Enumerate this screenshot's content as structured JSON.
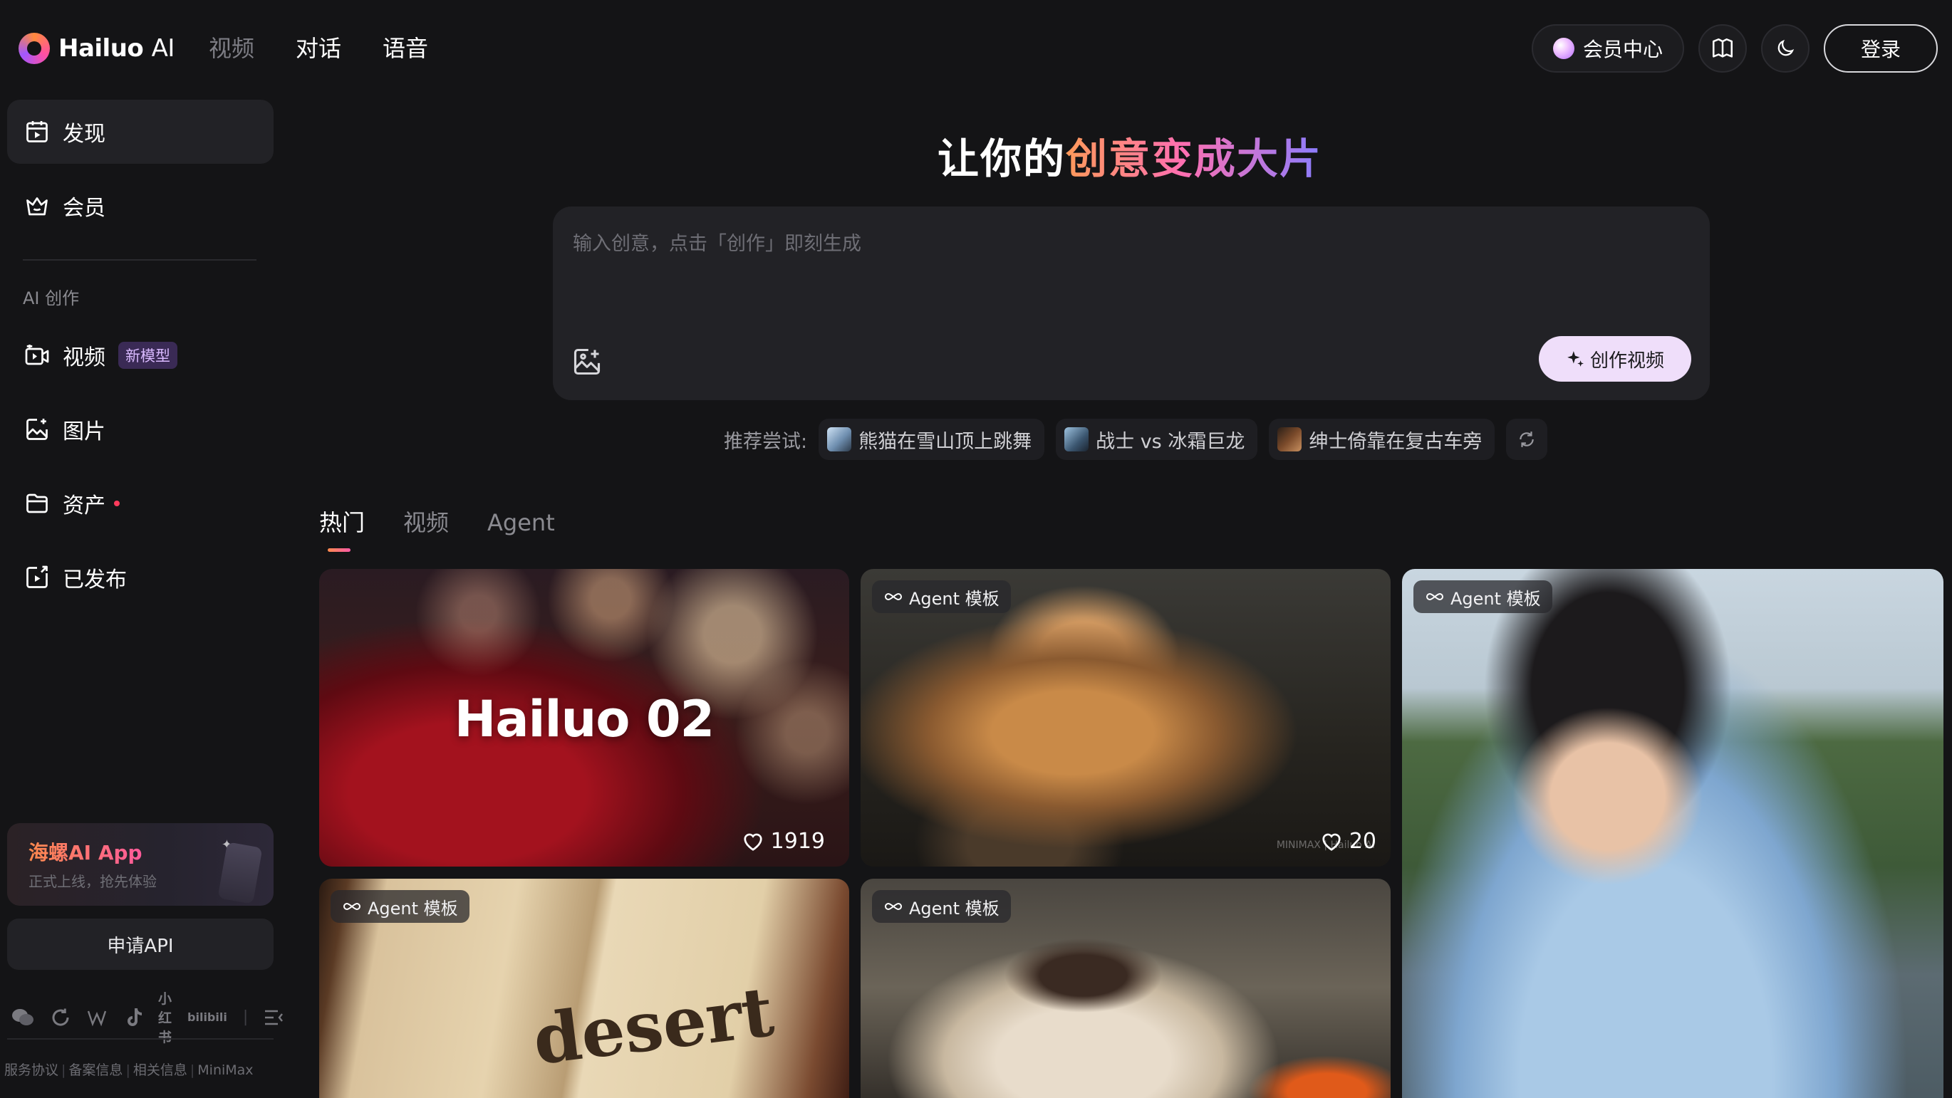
{
  "app": {
    "brand": "Hailuo",
    "brand_suffix": "AI"
  },
  "topnav": {
    "items": [
      {
        "label": "视频",
        "active": false
      },
      {
        "label": "对话",
        "active": true
      },
      {
        "label": "语音",
        "active": true
      }
    ]
  },
  "header_right": {
    "member_center_label": "会员中心",
    "login_label": "登录"
  },
  "sidebar": {
    "discover_label": "发现",
    "member_label": "会员",
    "section_title": "AI 创作",
    "video_label": "视频",
    "video_badge": "新模型",
    "image_label": "图片",
    "assets_label": "资产",
    "published_label": "已发布",
    "app_card": {
      "title": "海螺AI App",
      "subtitle": "正式上线，抢先体验"
    },
    "api_label": "申请API",
    "social_xhs": "小红书",
    "social_bili": "bilibili",
    "footer_links": [
      "服务协议",
      "备案信息",
      "相关信息",
      "MiniMax"
    ]
  },
  "hero": {
    "title_plain": "让你的",
    "title_gradient": "创意变成大片"
  },
  "prompt": {
    "placeholder": "输入创意，点击「创作」即刻生成",
    "create_label": "创作视频"
  },
  "suggestions": {
    "label": "推荐尝试:",
    "items": [
      "熊猫在雪山顶上跳舞",
      "战士 vs 冰霜巨龙",
      "绅士倚靠在复古车旁"
    ]
  },
  "tabs": [
    {
      "label": "热门",
      "active": true
    },
    {
      "label": "视频",
      "active": false
    },
    {
      "label": "Agent",
      "active": false
    }
  ],
  "cards": {
    "card1": {
      "caption": "Hailuo 02",
      "likes": "1919"
    },
    "card2": {
      "tag": "Agent 模板",
      "likes": "20",
      "watermark": "MINIMAX | Hailuo AI"
    },
    "card3": {
      "tag": "Agent 模板"
    },
    "card4": {
      "tag": "Agent 模板",
      "word": "desert"
    },
    "card5": {
      "tag": "Agent 模板"
    }
  },
  "colors": {
    "background": "#141416",
    "panel": "#222226",
    "accent_orange": "#ff8a4d",
    "accent_pink": "#ff5aa8",
    "accent_violet": "#8a7dff",
    "create_button_bg": "#efdefa"
  }
}
